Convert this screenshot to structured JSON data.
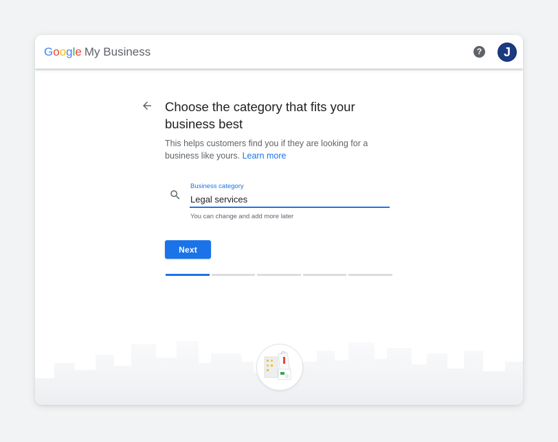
{
  "header": {
    "logo": {
      "google_letters": [
        "G",
        "o",
        "o",
        "g",
        "l",
        "e"
      ],
      "product": "My Business"
    },
    "help_icon": "help-circle-icon",
    "avatar_initial": "J"
  },
  "main": {
    "back_icon": "arrow-back-icon",
    "title": "Choose the category that fits your business best",
    "description": "This helps customers find you if they are looking for a business like yours.",
    "learn_more": "Learn more",
    "field": {
      "icon": "search-icon",
      "label": "Business category",
      "value": "Legal services",
      "hint": "You can change and add more later"
    },
    "next_label": "Next",
    "progress": {
      "total_steps": 5,
      "current_step": 1
    }
  },
  "illustration": {
    "icon": "storefront-shopping-icon"
  },
  "colors": {
    "accent": "#1a73e8",
    "google_blue": "#4285f4",
    "google_red": "#ea4335",
    "google_yellow": "#fbbc05",
    "google_green": "#34a853",
    "avatar_bg": "#1a3a82"
  }
}
